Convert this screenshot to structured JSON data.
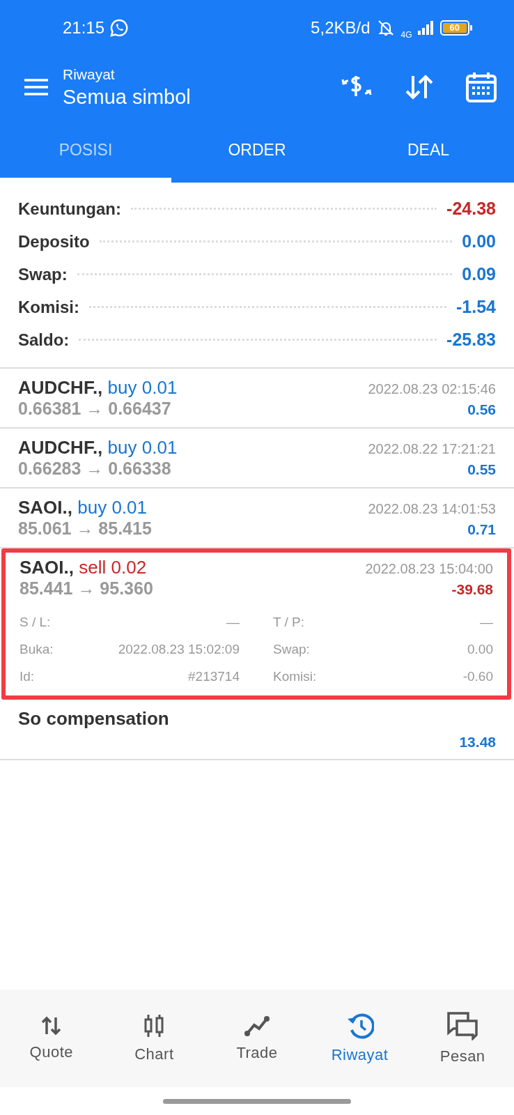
{
  "status_bar": {
    "time": "21:15",
    "network_speed": "5,2KB/d",
    "network_type": "4G",
    "battery": "60"
  },
  "header": {
    "subtitle": "Riwayat",
    "title": "Semua simbol"
  },
  "tabs": [
    {
      "label": "POSISI",
      "selected": true
    },
    {
      "label": "ORDER",
      "selected": false
    },
    {
      "label": "DEAL",
      "selected": false
    }
  ],
  "summary": [
    {
      "label": "Keuntungan:",
      "value": "-24.38",
      "color": "#c62828"
    },
    {
      "label": "Deposito",
      "value": "0.00",
      "color": "#1976d2"
    },
    {
      "label": "Swap:",
      "value": "0.09",
      "color": "#1976d2"
    },
    {
      "label": "Komisi:",
      "value": "-1.54",
      "color": "#1976d2"
    },
    {
      "label": "Saldo:",
      "value": "-25.83",
      "color": "#1976d2"
    }
  ],
  "deals": [
    {
      "kind": "trade",
      "symbol": "AUDCHF.,",
      "side": "buy",
      "volume": "0.01",
      "prices": "0.66381 → 0.66437",
      "time": "2022.08.23 02:15:46",
      "profit": "0.56",
      "loss": false,
      "highlighted": false
    },
    {
      "kind": "trade",
      "symbol": "AUDCHF.,",
      "side": "buy",
      "volume": "0.01",
      "prices": "0.66283 → 0.66338",
      "time": "2022.08.22 17:21:21",
      "profit": "0.55",
      "loss": false,
      "highlighted": false
    },
    {
      "kind": "trade",
      "symbol": "SAOI.,",
      "side": "buy",
      "volume": "0.01",
      "prices": "85.061 → 85.415",
      "time": "2022.08.23 14:01:53",
      "profit": "0.71",
      "loss": false,
      "highlighted": false
    },
    {
      "kind": "trade",
      "symbol": "SAOI.,",
      "side": "sell",
      "volume": "0.02",
      "prices": "85.441 → 95.360",
      "time": "2022.08.23 15:04:00",
      "profit": "-39.68",
      "loss": true,
      "highlighted": true,
      "details": [
        {
          "label": "S / L:",
          "value": "—"
        },
        {
          "label": "T / P:",
          "value": "—"
        },
        {
          "label": "Buka:",
          "value": "2022.08.23 15:02:09"
        },
        {
          "label": "Swap:",
          "value": "0.00"
        },
        {
          "label": "Id:",
          "value": "#213714"
        },
        {
          "label": "Komisi:",
          "value": "-0.60"
        }
      ]
    },
    {
      "kind": "balance",
      "symbol": "So compensation",
      "profit": "13.48",
      "loss": false,
      "highlighted": false
    }
  ],
  "nav": [
    {
      "label": "Quote",
      "selected": false
    },
    {
      "label": "Chart",
      "selected": false
    },
    {
      "label": "Trade",
      "selected": false
    },
    {
      "label": "Riwayat",
      "selected": true
    },
    {
      "label": "Pesan",
      "selected": false
    }
  ]
}
